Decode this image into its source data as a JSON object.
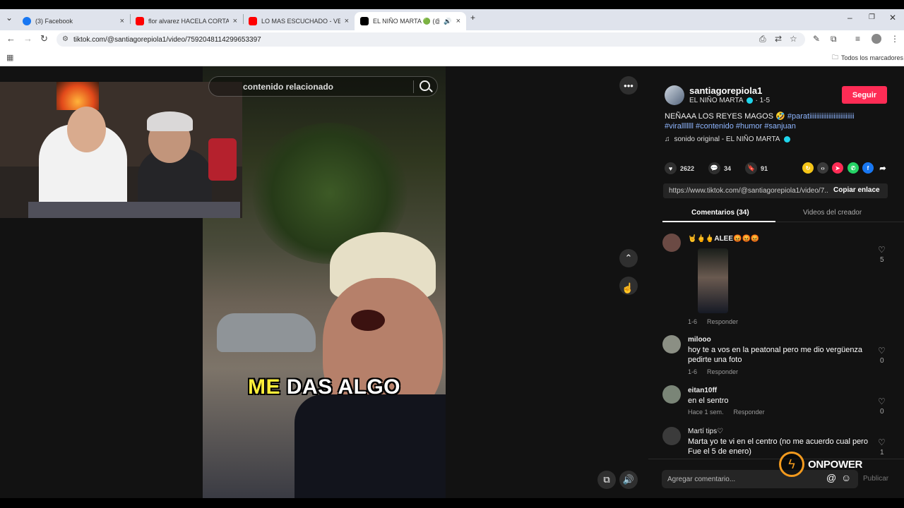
{
  "browser": {
    "tabs": [
      {
        "label": "(3) Facebook",
        "color": "#1877f2"
      },
      {
        "label": "flor alvarez HACELA CORTA MC",
        "color": "#ff0000"
      },
      {
        "label": "LO MAS ESCUCHADO - VERANO",
        "color": "#ff0000"
      },
      {
        "label": "EL NIÑO MARTA 🟢 (@san",
        "color": "#000000"
      }
    ],
    "url": "tiktok.com/@santiagorepiola1/video/7592048114299653397",
    "bookmarks_label": "Todos los marcadores"
  },
  "video": {
    "search_placeholder": "contenido relacionado",
    "caption_highlight": "ME",
    "caption_rest": "DAS ALGO"
  },
  "creator": {
    "username": "santiagorepiola1",
    "display_name": "EL NIÑO MARTA",
    "date": "· 1-5",
    "follow_label": "Seguir",
    "description_text": "NEÑAAA LOS REYES MAGOS 🤣",
    "hashtags_line1": "#paratiiiiiiiiiiiiiiiiiiiiiiiiii",
    "hashtags_line2": "#viralllllll #contenido #humor #sanjuan",
    "sound": "sonido original - EL NIÑO MARTA"
  },
  "stats": {
    "likes": "2622",
    "comments": "34",
    "saves": "91"
  },
  "share": {
    "link": "https://www.tiktok.com/@santiagorepiola1/video/7...",
    "copy_label": "Copiar enlace"
  },
  "comment_tabs": {
    "comments": "Comentarios (34)",
    "creator_videos": "Videos del creador"
  },
  "comments": [
    {
      "user": "🤘🖕🖕ALEE😡😡😡",
      "text": "",
      "date": "1-6",
      "reply": "Responder",
      "likes": "5",
      "avatar_color": "#6b4a44"
    },
    {
      "user": "milooo",
      "text": "hoy te a vos en la peatonal pero me dio vergüenza pedirte una foto",
      "date": "1-6",
      "reply": "Responder",
      "likes": "0",
      "avatar_color": "#8b8f84"
    },
    {
      "user": "eitan10ff",
      "text": "en el sentro",
      "date": "Hace 1 sem.",
      "reply": "Responder",
      "likes": "0",
      "avatar_color": "#7a8577"
    },
    {
      "user": "Martí tips♡",
      "text": "Marta yo te vi en el centro (no me acuerdo cual pero Fue el 5 de enero)",
      "date": "",
      "reply": "",
      "likes": "1",
      "avatar_color": "#3b3b3b"
    }
  ],
  "add_comment": {
    "placeholder": "Agregar comentario...",
    "publish": "Publicar"
  },
  "watermark": "ONPOWER"
}
